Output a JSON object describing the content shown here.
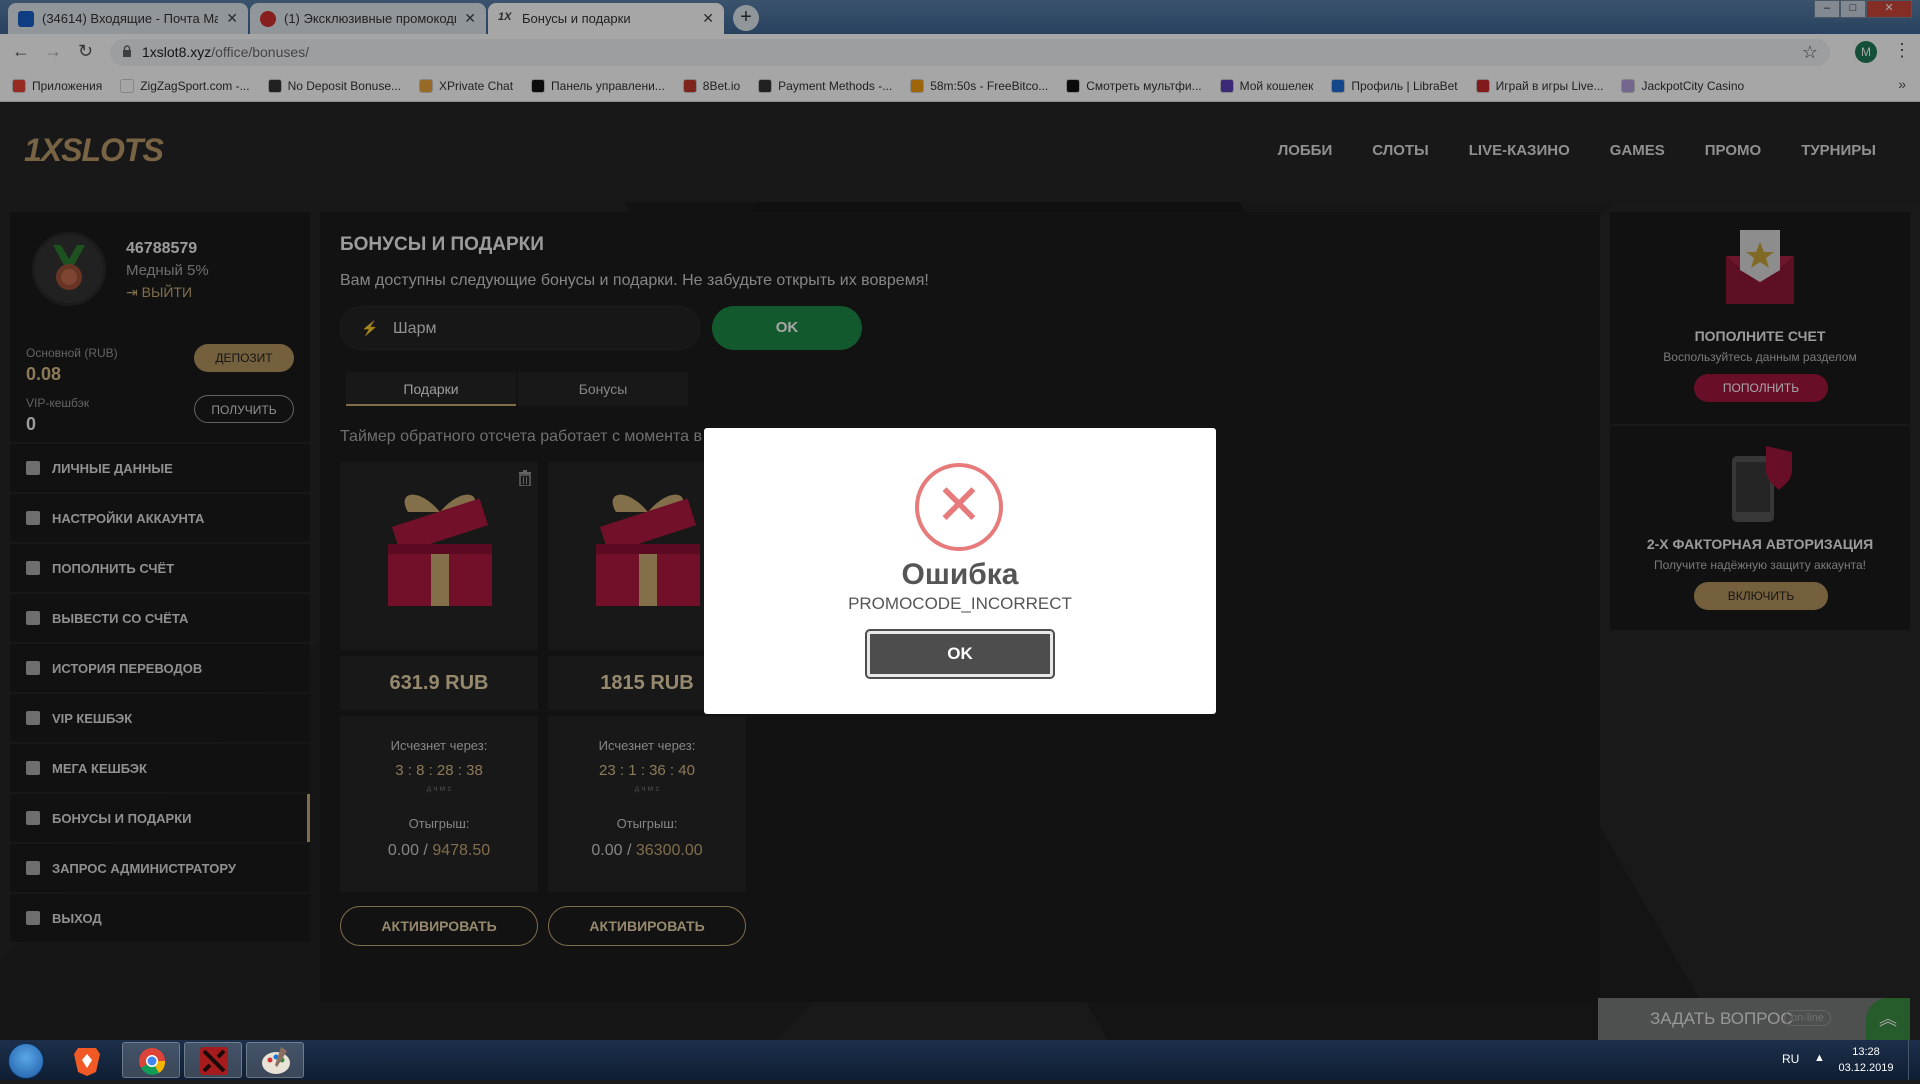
{
  "browser": {
    "tabs": [
      {
        "title": "(34614) Входящие - Почта Mail.",
        "favicon_color": "#1a5fc7"
      },
      {
        "title": "(1) Эксклюзивные промокоды",
        "favicon_color": "#d03030"
      },
      {
        "title": "Бонусы и подарки",
        "favicon_color": "#444444"
      }
    ],
    "url_host": "1xslot8.xyz",
    "url_path": "/office/bonuses/",
    "profile_initial": "M",
    "bookmarks": [
      {
        "label": "Приложения",
        "icon_color": "#e94335"
      },
      {
        "label": "ZigZagSport.com -...",
        "icon_color": "#ffffff"
      },
      {
        "label": "No Deposit Bonuse...",
        "icon_color": "#333333"
      },
      {
        "label": "XPrivate Chat",
        "icon_color": "#e8a33c"
      },
      {
        "label": "Панель управлени...",
        "icon_color": "#111111"
      },
      {
        "label": "8Bet.io",
        "icon_color": "#c0392b"
      },
      {
        "label": "Payment Methods -...",
        "icon_color": "#333333"
      },
      {
        "label": "58m:50s - FreeBitco...",
        "icon_color": "#f39c12"
      },
      {
        "label": "Смотреть мультфи...",
        "icon_color": "#111111"
      },
      {
        "label": "Мой кошелек",
        "icon_color": "#5b3fb8"
      },
      {
        "label": "Профиль | LibraBet",
        "icon_color": "#1c6fd6"
      },
      {
        "label": "Играй в игры Live...",
        "icon_color": "#c62828"
      },
      {
        "label": "JackpotCity Casino",
        "icon_color": "#b39ddb"
      }
    ]
  },
  "site": {
    "logo": "1XSLOTS",
    "nav": [
      "ЛОББИ",
      "СЛОТЫ",
      "LIVE-КАЗИНО",
      "GAMES",
      "ПРОМО",
      "ТУРНИРЫ"
    ],
    "profile": {
      "user_id": "46788579",
      "rank": "Медный 5%",
      "logout": "ВЫЙТИ",
      "main_label": "Основной (RUB)",
      "main_value": "0.08",
      "deposit_btn": "ДЕПОЗИТ",
      "vip_label": "VIP-кешбэк",
      "vip_value": "0",
      "get_btn": "ПОЛУЧИТЬ"
    },
    "menu": [
      "ЛИЧНЫЕ ДАННЫЕ",
      "НАСТРОЙКИ АККАУНТА",
      "ПОПОЛНИТЬ СЧЁТ",
      "ВЫВЕСТИ СО СЧЁТА",
      "ИСТОРИЯ ПЕРЕВОДОВ",
      "VIP КЕШБЭК",
      "МЕГА КЕШБЭК",
      "БОНУСЫ И ПОДАРКИ",
      "ЗАПРОС АДМИНИСТРАТОРУ",
      "ВЫХОД"
    ],
    "active_menu": "БОНУСЫ И ПОДАРКИ",
    "main": {
      "title": "БОНУСЫ И ПОДАРКИ",
      "subtitle": "Вам доступны следующие бонусы и подарки. Не забудьте открыть их вовремя!",
      "promo_value": "Шарм",
      "ok_btn": "OK",
      "tabs": [
        "Подарки",
        "Бонусы"
      ],
      "timer_note": "Таймер обратного отсчета работает с момента в",
      "cards": [
        {
          "amount": "631.9 RUB",
          "disappears": "Исчезнет через:",
          "timer": "3  :  8  :  28  :  38",
          "units": "д        ч        м        с",
          "wager_label": "Отыгрыш:",
          "wager_done": "0.00",
          "wager_total": "9478.50",
          "activate": "АКТИВИРОВАТЬ"
        },
        {
          "amount": "1815 RUB",
          "disappears": "Исчезнет через:",
          "timer": "23  :  1  :  36  :  40",
          "units": "д        ч        м        с",
          "wager_label": "Отыгрыш:",
          "wager_done": "0.00",
          "wager_total": "36300.00",
          "activate": "АКТИВИРОВАТЬ"
        }
      ]
    },
    "right": {
      "deposit_title": "ПОПОЛНИТЕ СЧЕТ",
      "deposit_sub": "Воспользуйтесь данным разделом",
      "deposit_btn": "ПОПОЛНИТЬ",
      "twofa_title": "2-Х ФАКТОРНАЯ АВТОРИЗАЦИЯ",
      "twofa_sub": "Получите надёжную защиту аккаунта!",
      "twofa_btn": "ВКЛЮЧИТЬ"
    },
    "chat": {
      "label": "ЗАДАТЬ ВОПРОС",
      "status": "on-line"
    }
  },
  "modal": {
    "title": "Ошибка",
    "message": "PROMOCODE_INCORRECT",
    "ok": "OK"
  },
  "taskbar": {
    "lang": "RU",
    "time": "13:28",
    "date": "03.12.2019"
  },
  "colors": {
    "accent_gold": "#c5a873",
    "green_button": "#1d8a47",
    "error_red": "#e77a7a",
    "gift_red": "#b0183f"
  }
}
